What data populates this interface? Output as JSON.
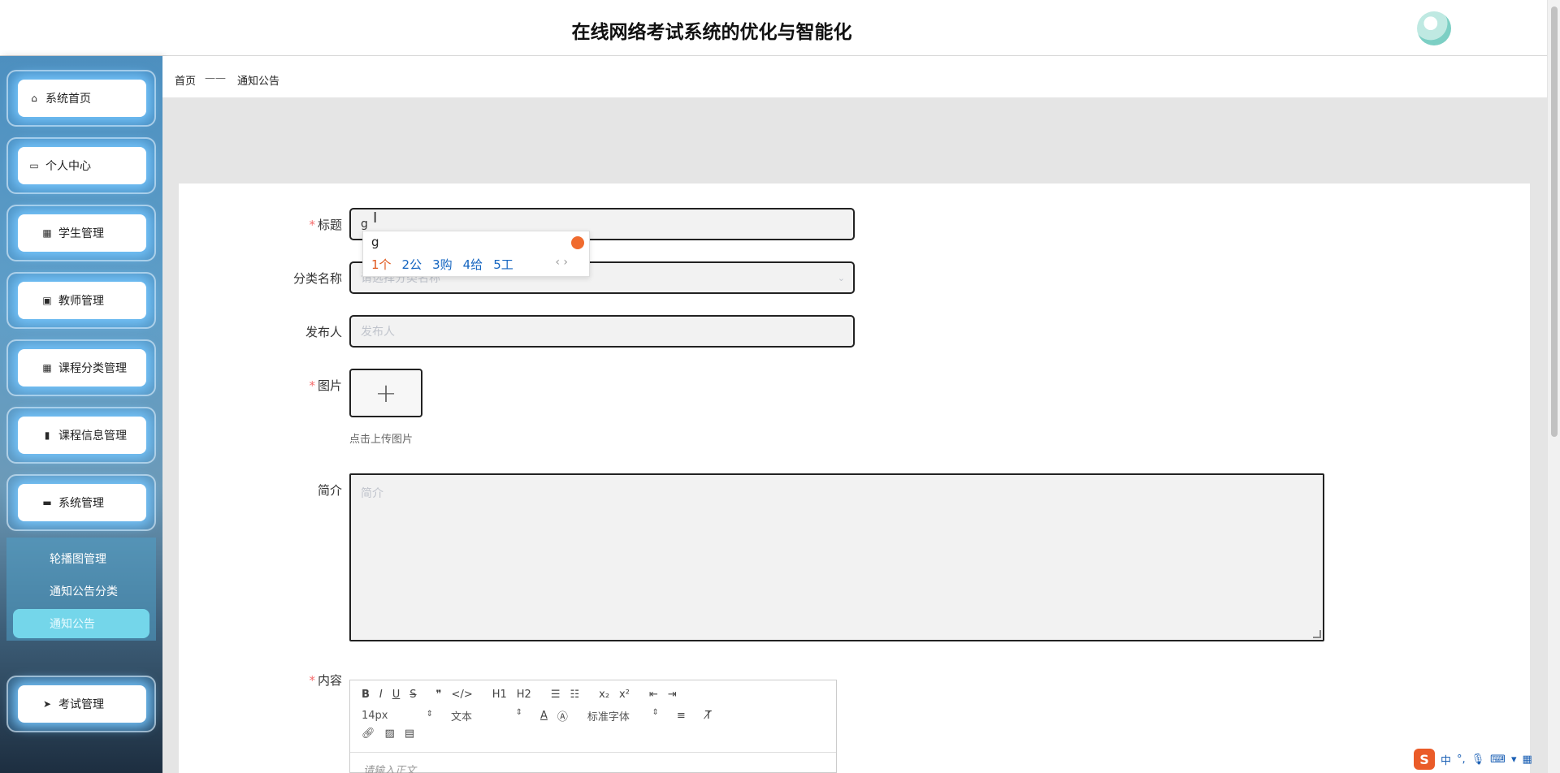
{
  "header": {
    "title": "在线网络考试系统的优化与智能化"
  },
  "sidebar": {
    "items": [
      {
        "label": "系统首页",
        "icon": "home-icon"
      },
      {
        "label": "个人中心",
        "icon": "card-icon"
      },
      {
        "label": "学生管理",
        "icon": "grid-icon"
      },
      {
        "label": "教师管理",
        "icon": "clipboard-icon"
      },
      {
        "label": "课程分类管理",
        "icon": "grid-icon"
      },
      {
        "label": "课程信息管理",
        "icon": "bar-chart-icon"
      },
      {
        "label": "系统管理",
        "icon": "monitor-icon"
      },
      {
        "label": "考试管理",
        "icon": "paper-plane-icon"
      }
    ],
    "submenu": [
      {
        "label": "轮播图管理"
      },
      {
        "label": "通知公告分类"
      },
      {
        "label": "通知公告"
      }
    ]
  },
  "breadcrumb": {
    "home": "首页",
    "separator": "——",
    "current": "通知公告"
  },
  "form": {
    "title": {
      "label": "标题",
      "value": "g"
    },
    "category": {
      "label": "分类名称",
      "placeholder": "请选择分类名称"
    },
    "publisher": {
      "label": "发布人",
      "placeholder": "发布人"
    },
    "image": {
      "label": "图片",
      "tip": "点击上传图片"
    },
    "summary": {
      "label": "简介",
      "placeholder": "简介"
    },
    "content": {
      "label": "内容"
    }
  },
  "editor": {
    "toolbar_row1": [
      "B",
      "I",
      "U",
      "S",
      "❞",
      "</>",
      "H1",
      "H2",
      "☰",
      "☷",
      "x₂",
      "x²",
      "⇤",
      "⇥"
    ],
    "size": "14px",
    "style": "文本",
    "font": "标准字体",
    "placeholder": "请输入正文"
  },
  "ime": {
    "composition": "g",
    "candidates": [
      "1个",
      "2公",
      "3购",
      "4给",
      "5工"
    ],
    "nav": "‹ ›"
  },
  "tray": {
    "mode": "中",
    "punct": "°,"
  }
}
